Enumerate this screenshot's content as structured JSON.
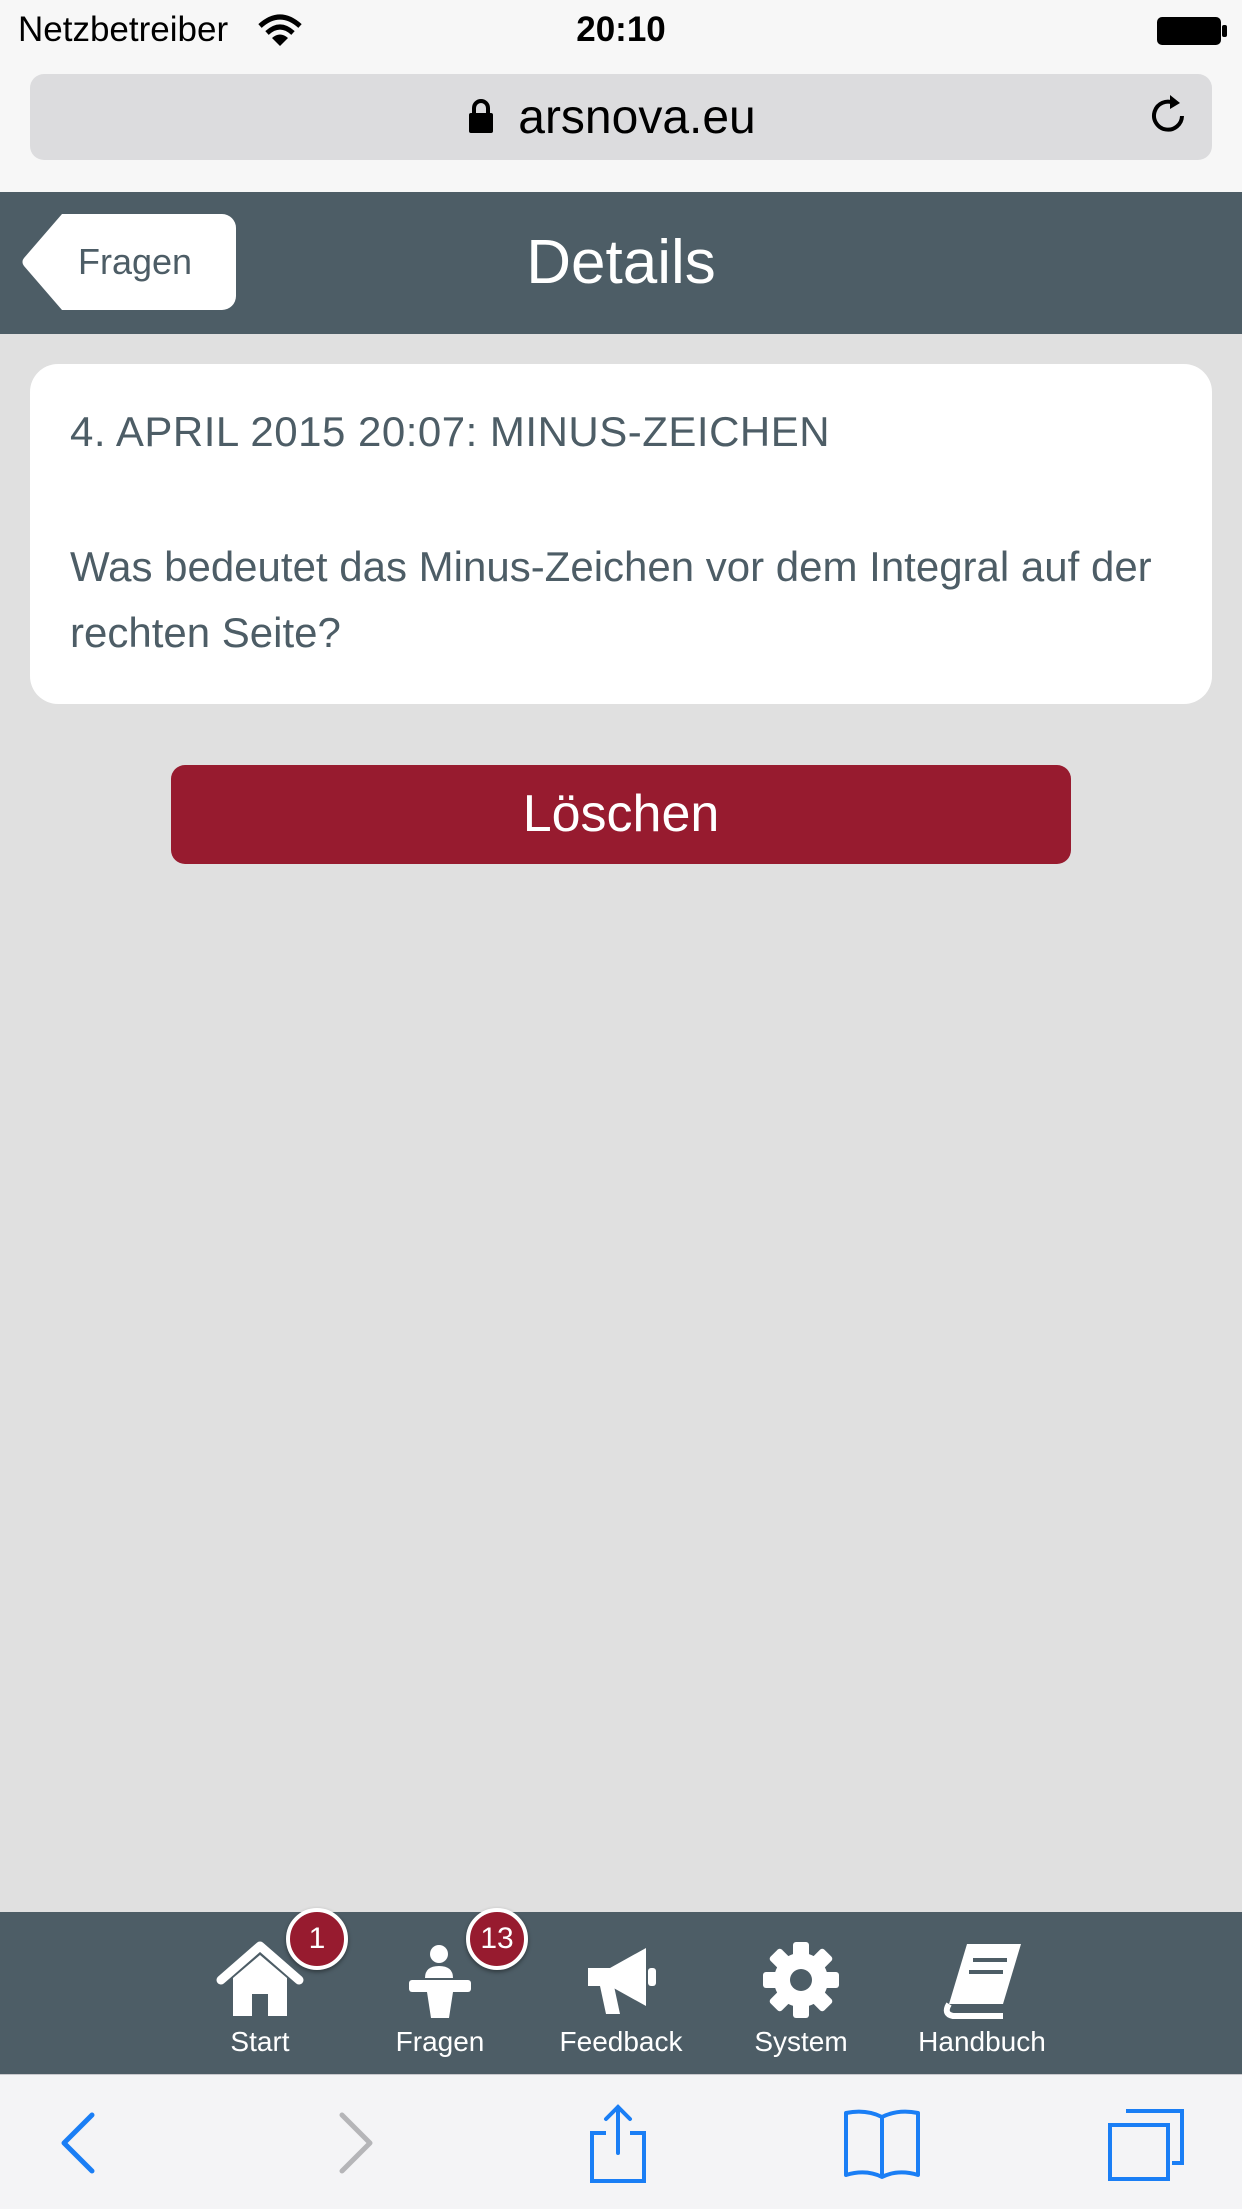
{
  "status_bar": {
    "carrier": "Netzbetreiber",
    "time": "20:10"
  },
  "browser": {
    "url": "arsnova.eu"
  },
  "header": {
    "back_label": "Fragen",
    "title": "Details"
  },
  "question": {
    "heading": "4. APRIL 2015 20:07: MINUS-ZEICHEN",
    "body": "Was bedeutet das Minus-Zeichen vor dem Integral auf der rechten Seite?"
  },
  "actions": {
    "delete_label": "Löschen"
  },
  "tabs": [
    {
      "label": "Start",
      "icon": "home-icon",
      "badge": "1"
    },
    {
      "label": "Fragen",
      "icon": "presenter-icon",
      "badge": "13"
    },
    {
      "label": "Feedback",
      "icon": "megaphone-icon"
    },
    {
      "label": "System",
      "icon": "gear-icon"
    },
    {
      "label": "Handbuch",
      "icon": "book-icon"
    }
  ],
  "safari_toolbar": [
    "back-arrow-icon",
    "forward-arrow-icon",
    "share-icon",
    "bookmarks-icon",
    "tabs-icon"
  ],
  "colors": {
    "header": "#4d5d66",
    "accent": "#971b2f",
    "background": "#e0e0e0",
    "link_blue": "#1a7ef5"
  }
}
